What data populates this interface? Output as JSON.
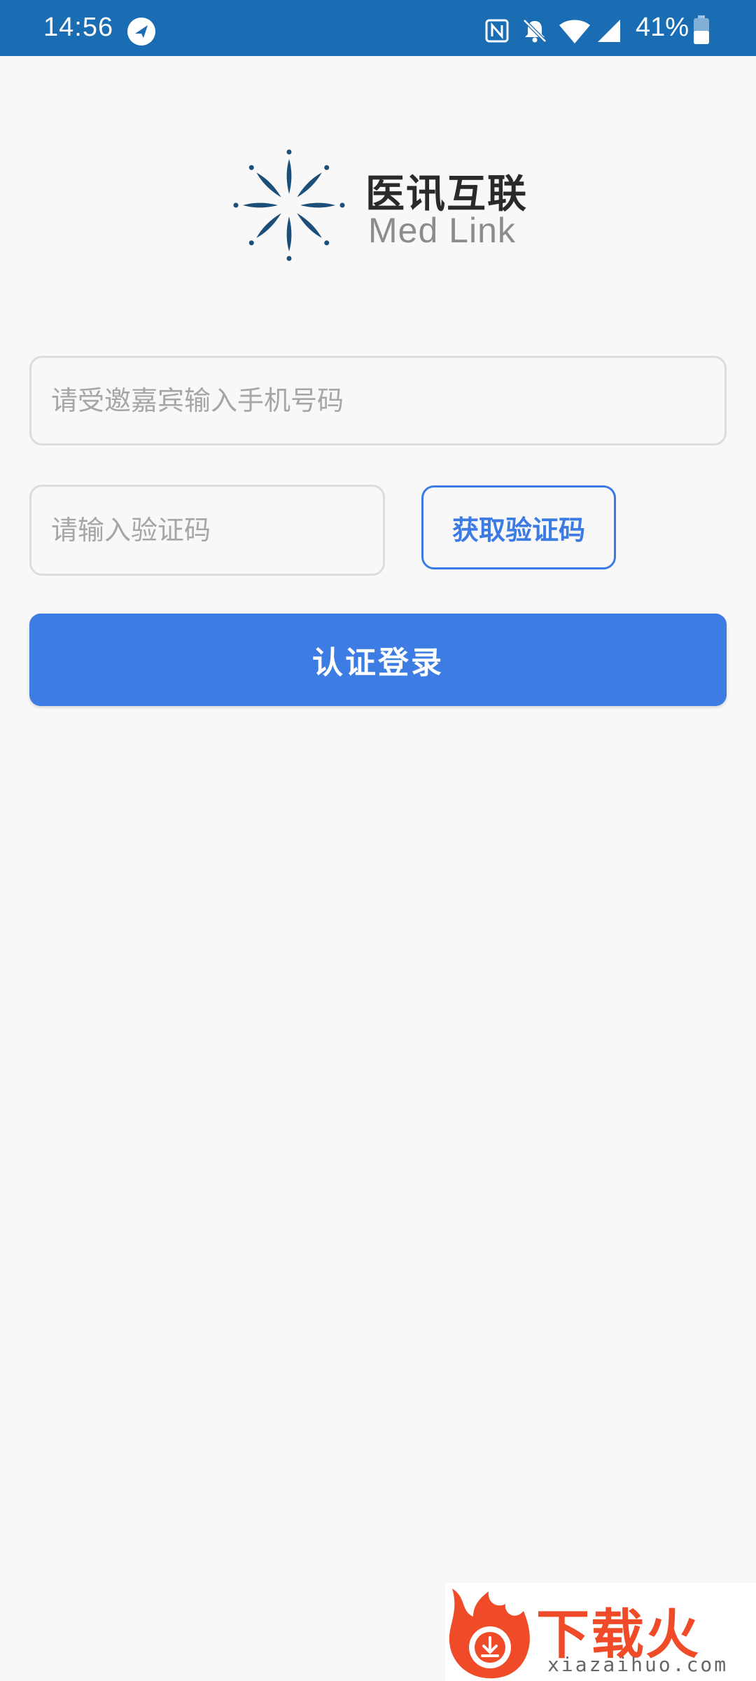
{
  "status_bar": {
    "time": "14:56",
    "battery": "41%",
    "icons": [
      "app-notification-icon",
      "nfc-icon",
      "bell-mute-icon",
      "wifi-icon",
      "signal-icon",
      "battery-icon"
    ]
  },
  "logo": {
    "name_cn": "医讯互联",
    "name_en": "Med Link",
    "color": "#1b4f7a"
  },
  "form": {
    "phone_placeholder": "请受邀嘉宾输入手机号码",
    "phone_value": "",
    "code_placeholder": "请输入验证码",
    "code_value": "",
    "get_code_label": "获取验证码",
    "login_label": "认证登录"
  },
  "watermark": {
    "name_cn": "下载火",
    "domain": "xiazaihuo.com"
  },
  "colors": {
    "status_bar": "#1a6db3",
    "accent": "#3d7de3",
    "background": "#f8f8f8",
    "watermark": "#f04b28"
  }
}
